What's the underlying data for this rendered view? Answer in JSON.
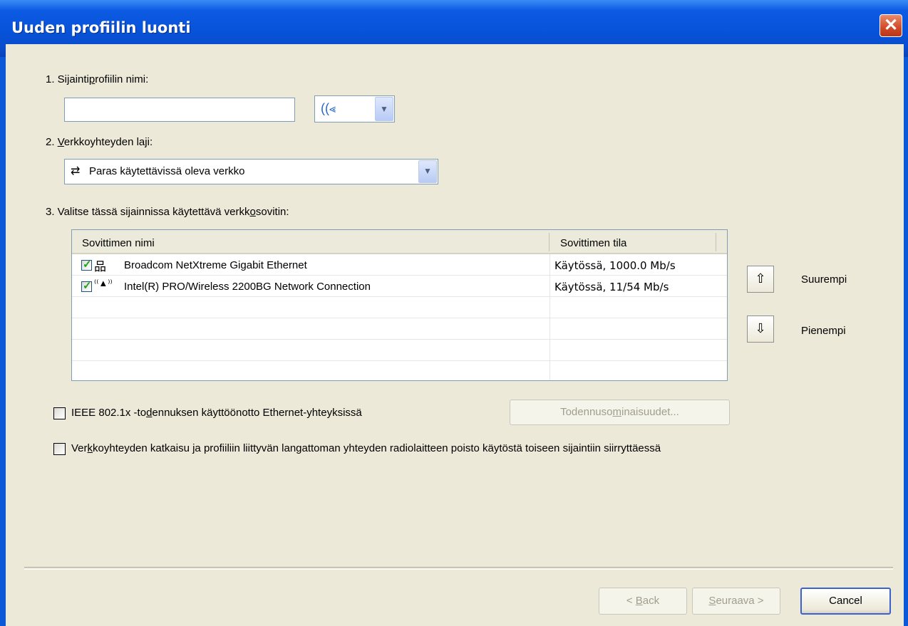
{
  "window": {
    "title": "Uuden profiilin luonti",
    "close_label": "✕"
  },
  "step1": {
    "label_pre": "1. Sijainti",
    "label_u": "p",
    "label_post": "rofiilin nimi:",
    "name_value": "",
    "icon_combo": "wireless-icon"
  },
  "step2": {
    "label_pre": "2. ",
    "label_u": "V",
    "label_post": "erkkoyhteyden laji:",
    "selected": "Paras käytettävissä oleva verkko"
  },
  "step3": {
    "label_pre": "3. Valitse tässä sijainnissa käytettävä verkk",
    "label_u": "o",
    "label_post": "sovitin:",
    "columns": [
      "Sovittimen nimi",
      "Sovittimen tila"
    ],
    "rows": [
      {
        "name": "Broadcom NetXtreme Gigabit Ethernet",
        "status": "Käytössä, 1000.0 Mb/s",
        "checked": true,
        "icon": "ethernet-icon"
      },
      {
        "name": "Intel(R) PRO/Wireless 2200BG Network Connection",
        "status": "Käytössä, 11/54 Mb/s",
        "checked": true,
        "icon": "wireless-antenna-icon"
      }
    ]
  },
  "priority": {
    "up_label": "Suurempi",
    "down_label": "Pienempi"
  },
  "ieee": {
    "label_pre": "IEEE 802.1x -to",
    "label_u": "d",
    "label_post": "ennuksen käyttöönotto Ethernet-yhteyksissä",
    "checked": false,
    "button_pre": "Todennuso",
    "button_u": "m",
    "button_post": "inaisuudet..."
  },
  "disconnect": {
    "label_pre": "Ver",
    "label_u": "k",
    "label_post": "koyhteyden katkaisu ja profiiliin liittyvän langattoman yhteyden radiolaitteen poisto käytöstä toiseen sijaintiin siirryttäessä",
    "checked": false
  },
  "footer": {
    "back_pre": "< ",
    "back_u": "B",
    "back_post": "ack",
    "next_u": "S",
    "next_post": "euraava >",
    "cancel": "Cancel"
  }
}
